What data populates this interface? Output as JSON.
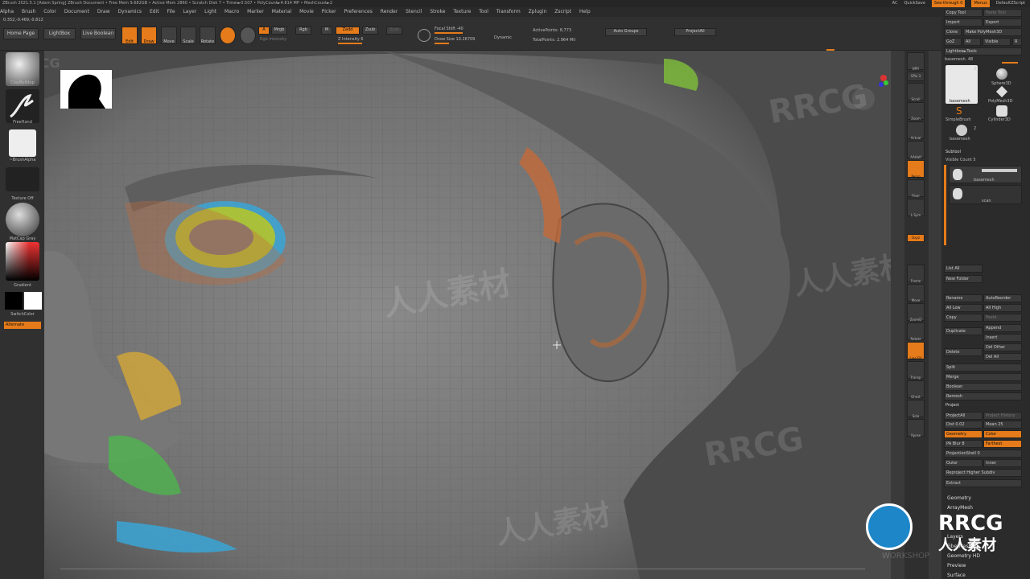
{
  "titlebar": {
    "text": "ZBrush 2021.5.1 [Adam Spring]   ZBrush Document   • Free Mem 9.682GB • Active Mem 2860 • Scratch Disk 7 • Timer►0.507 • PolyCount►4.814 MP • MeshCount►2"
  },
  "topright": {
    "ac": "AC",
    "quicksave": "QuickSave",
    "seethrough": "See-through   0",
    "menus": "Menus",
    "script": "DefaultZScript"
  },
  "menus": [
    "Alpha",
    "Brush",
    "Color",
    "Document",
    "Draw",
    "Dynamics",
    "Edit",
    "File",
    "Layer",
    "Light",
    "Macro",
    "Marker",
    "Material",
    "Movie",
    "Picker",
    "Preferences",
    "Render",
    "Stencil",
    "Stroke",
    "Texture",
    "Tool",
    "Transform",
    "Zplugin",
    "Zscript",
    "Help"
  ],
  "coords": "0.352,-0.469,-0.812",
  "toolbar": {
    "home": "Home Page",
    "lightbox": "LightBox",
    "liveboolean": "Live Boolean",
    "edit": "Edit",
    "draw": "Draw",
    "move": "Move",
    "scale": "Scale",
    "rotate": "Rotate",
    "a": "A",
    "mrgb": "Mrgb",
    "rgb": "Rgb",
    "m": "M",
    "zadd": "Zadd",
    "zsub": "Zsub",
    "zcut": "Zcut",
    "rgbintensity": "Rgb Intensity",
    "zintensity": "Z Intensity 6",
    "focal": "Focal Shift -40",
    "drawsize": "Draw Size 10.26709",
    "dynamic": "Dynamic",
    "activepoints": "ActivePoints: 8,773",
    "totalpoints": "TotalPoints: 2.964 Mil",
    "autogroups": "Auto Groups",
    "projectall": "ProjectAll"
  },
  "leftshelf": {
    "brush": "ClayBuildup",
    "stroke": "FreeHand",
    "alpha": "~BrushAlpha",
    "texture": "Texture Off",
    "material": "MatCap Gray",
    "gradient": "Gradient",
    "switchcolor": "SwitchColor",
    "alternate": "Alternate"
  },
  "rightshelf": [
    "BPR",
    "SPix 3",
    "Scroll",
    "Zoom",
    "Actual",
    "AAHalf",
    "Persp",
    "Floor",
    "L.Sym",
    "Gxyz",
    "Frame",
    "Move",
    "ZoomD",
    "Rotate",
    "Line Fill",
    "Transp",
    "Ghost",
    "Solo",
    "Xpose"
  ],
  "panel": {
    "copytool": "Copy Tool",
    "pastetool": "Paste Tool",
    "import": "Import",
    "export": "Export",
    "clone": "Clone",
    "makepolymesh": "Make PolyMesh3D",
    "goz": "GoZ",
    "all": "All",
    "visible": "Visible",
    "r": "R",
    "lightboxtools": "Lightbox►Tools",
    "basemesh48": "basemesh. 48",
    "t1": "basemesh",
    "t2": "Sphere3D",
    "t3": "PolyMesh3D",
    "t4": "SimpleBrush",
    "t5": "Cylinder3D",
    "t6": "basemesh",
    "n2": "2",
    "subtool": "Subtool",
    "visiblecount": "Visible Count 5",
    "s1": "basemesh",
    "s2": "scan",
    "listall": "List All",
    "newfolder": "New Folder",
    "rename": "Rename",
    "autoreorder": "AutoReorder",
    "alllow": "All Low",
    "allhigh": "All High",
    "copy": "Copy",
    "paste": "Paste",
    "duplicate": "Duplicate",
    "append": "Append",
    "insert": "Insert",
    "delete": "Delete",
    "delother": "Del Other",
    "delall": "Del All",
    "split": "Split",
    "merge": "Merge",
    "boolean": "Boolean",
    "remesh": "Remesh",
    "project": "Project",
    "projectall": "ProjectAll",
    "projecthistory": "Project History",
    "dist": "Dist 0.02",
    "mean": "Mean 25",
    "geometry": "Geometry",
    "color": "Color",
    "pablur": "PA Blur 8",
    "farthest": "Farthest",
    "projectionshell": "ProjectionShell 0",
    "outer": "Outer",
    "inner": "Inner",
    "reproject": "Reproject Higher Subdiv",
    "extract": "Extract",
    "geometry2": "Geometry",
    "arraymesh": "ArrayMesh",
    "layers": "Layers",
    "fibermesh": "FiberMesh",
    "geometryhd": "Geometry HD",
    "preview": "Preview",
    "surface": "Surface"
  },
  "watermark": {
    "logo": "RRCG",
    "cn": "人人素材",
    "sub": "WORKSHOP"
  },
  "colors": {
    "accent": "#e57b1a",
    "skin": "#7d7d7d",
    "orange": "#c46a3a",
    "green": "#7fbf3a",
    "blue": "#3aa6d6",
    "yellow": "#d4a837"
  }
}
